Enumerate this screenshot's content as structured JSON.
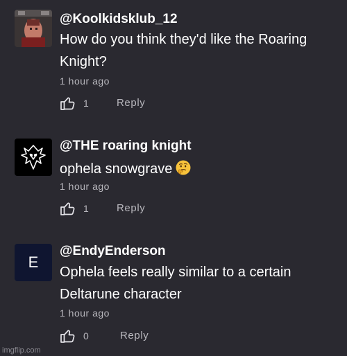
{
  "comments": [
    {
      "avatar_icon": "photo-avatar",
      "username": "@Koolkidsklub_12",
      "lines": [
        "How do you think they'd like the Roaring",
        "Knight?"
      ],
      "timestamp": "1 hour ago",
      "like_count": "1",
      "reply_label": "Reply"
    },
    {
      "avatar_icon": "knight-emblem-avatar",
      "username": "@THE roaring knight",
      "lines": [
        "ophela snowgrave"
      ],
      "emoji": "thinking-face-emoji",
      "timestamp": "1 hour ago",
      "like_count": "1",
      "reply_label": "Reply"
    },
    {
      "avatar_icon": "letter-avatar",
      "avatar_letter": "E",
      "username": "@EndyEnderson",
      "lines": [
        "Ophela feels really similar to a certain",
        "Deltarune character"
      ],
      "timestamp": "1 hour ago",
      "like_count": "0",
      "reply_label": "Reply"
    }
  ],
  "watermark": "imgflip.com",
  "colors": {
    "background": "#2a2930",
    "secondary_text": "#b8b7bd",
    "letter_avatar_bg": "#0f1530"
  }
}
